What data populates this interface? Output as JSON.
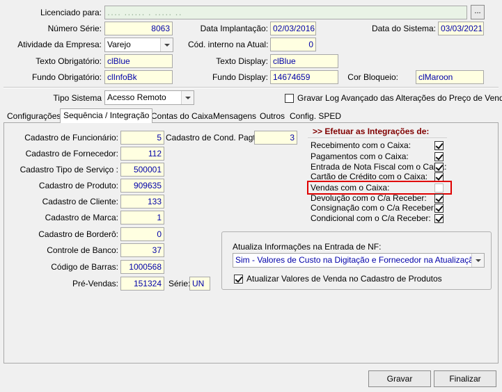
{
  "header": {
    "licenciado_label": "Licenciado para:",
    "licenciado_value": "․․․․ ․․․․․․ ․ ․․․․․ ․․",
    "ellipsis_label": "...",
    "numero_serie_label": "Número Série:",
    "numero_serie_value": "8063",
    "data_implantacao_label": "Data Implantação:",
    "data_implantacao_value": "02/03/2016",
    "data_sistema_label": "Data do Sistema:",
    "data_sistema_value": "03/03/2021",
    "atividade_label": "Atividade da Empresa:",
    "atividade_value": "Varejo",
    "cod_interno_label": "Cód. interno na Atual:",
    "cod_interno_value": "0",
    "texto_obrigatorio_label": "Texto Obrigatório:",
    "texto_obrigatorio_value": "clBlue",
    "texto_display_label": "Texto Display:",
    "texto_display_value": "clBlue",
    "fundo_obrigatorio_label": "Fundo Obrigatório:",
    "fundo_obrigatorio_value": "clInfoBk",
    "fundo_display_label": "Fundo Display:",
    "fundo_display_value": "14674659",
    "cor_bloqueio_label": "Cor Bloqueio:",
    "cor_bloqueio_value": "clMaroon",
    "tipo_sistema_label": "Tipo Sistema",
    "tipo_sistema_value": "Acesso Remoto",
    "gravar_log_label": "Gravar Log Avançado das Alterações do Preço de Venda",
    "gravar_log_checked": false
  },
  "tabs": [
    {
      "label": "Configurações",
      "active": false
    },
    {
      "label": "Sequência / Integração",
      "active": true
    },
    {
      "label": "Contas do Caixa",
      "active": false
    },
    {
      "label": "Mensagens",
      "active": false
    },
    {
      "label": "Outros",
      "active": false
    },
    {
      "label": "Config. SPED",
      "active": false
    }
  ],
  "sequencia": {
    "cadastro_funcionario_label": "Cadastro de Funcionário:",
    "cadastro_funcionario_value": "5",
    "cadastro_cond_pagto_label": "Cadastro de Cond. Pagto:",
    "cadastro_cond_pagto_value": "3",
    "cadastro_fornecedor_label": "Cadastro de Fornecedor:",
    "cadastro_fornecedor_value": "112",
    "cadastro_tipo_servico_label": "Cadastro Tipo de Serviço :",
    "cadastro_tipo_servico_value": "500001",
    "cadastro_produto_label": "Cadastro de Produto:",
    "cadastro_produto_value": "909635",
    "cadastro_cliente_label": "Cadastro de Cliente:",
    "cadastro_cliente_value": "133",
    "cadastro_marca_label": "Cadastro de Marca:",
    "cadastro_marca_value": "1",
    "cadastro_bordero_label": "Cadastro de Borderô:",
    "cadastro_bordero_value": "0",
    "controle_banco_label": "Controle de Banco:",
    "controle_banco_value": "37",
    "codigo_barras_label": "Código de Barras:",
    "codigo_barras_value": "1000568",
    "pre_vendas_label": "Pré-Vendas:",
    "pre_vendas_value": "151324",
    "serie_label": "Série:",
    "serie_value": "UN"
  },
  "integracoes": {
    "title": ">> Efetuar as Integrações de:",
    "items": [
      {
        "label": "Recebimento com o Caixa:",
        "checked": true
      },
      {
        "label": "Pagamentos com o Caixa:",
        "checked": true
      },
      {
        "label": "Entrada de Nota Fiscal com o Caixa:",
        "checked": true
      },
      {
        "label": "Cartão de Crédito com o Caixa:",
        "checked": true
      },
      {
        "label": "Vendas com o Caixa:",
        "checked": false
      },
      {
        "label": "Devolução com o C/a Receber:",
        "checked": true
      },
      {
        "label": "Consignação com o C/a Receber:",
        "checked": true
      },
      {
        "label": "Condicional com o C/a Receber:",
        "checked": true
      }
    ]
  },
  "nf_group": {
    "label": "Atualiza Informações na Entrada de NF:",
    "select_value": "Sim - Valores de Custo na Digitação e Fornecedor na Atualização",
    "atualizar_label": "Atualizar Valores de Venda no Cadastro de Produtos",
    "atualizar_checked": true
  },
  "footer": {
    "gravar_label": "Gravar",
    "finalizar_label": "Finalizar"
  },
  "colors": {
    "highlight": "#e00000",
    "field_bg": "#ffffe1",
    "field_text": "#0000a8",
    "section_title": "#800000"
  }
}
